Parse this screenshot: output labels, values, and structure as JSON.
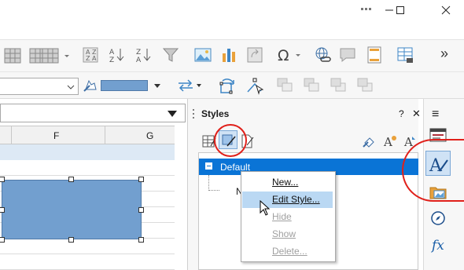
{
  "window": {
    "controls": {
      "minimize": "—",
      "maximize": "☐",
      "close": "✕"
    }
  },
  "toolbar": {
    "overflow": "»"
  },
  "toolbar2": {
    "line_color": "#729fcf"
  },
  "sheet": {
    "columns": [
      "F",
      "G"
    ],
    "shape_fill": "#729fcf"
  },
  "styles_panel": {
    "title": "Styles",
    "help": "?",
    "close": "✕",
    "menu": "≡",
    "tree": {
      "selected": "Default",
      "child_partial": "N"
    }
  },
  "context_menu": {
    "items": [
      {
        "label": "New...",
        "enabled": true
      },
      {
        "label": "Edit Style...",
        "enabled": true
      },
      {
        "label": "Hide",
        "enabled": false
      },
      {
        "label": "Show",
        "enabled": false
      },
      {
        "label": "Delete...",
        "enabled": false
      }
    ]
  },
  "colors": {
    "accent_blue": "#0a74d6",
    "highlight": "#bad8f3",
    "annotation_red": "#e0201a"
  }
}
